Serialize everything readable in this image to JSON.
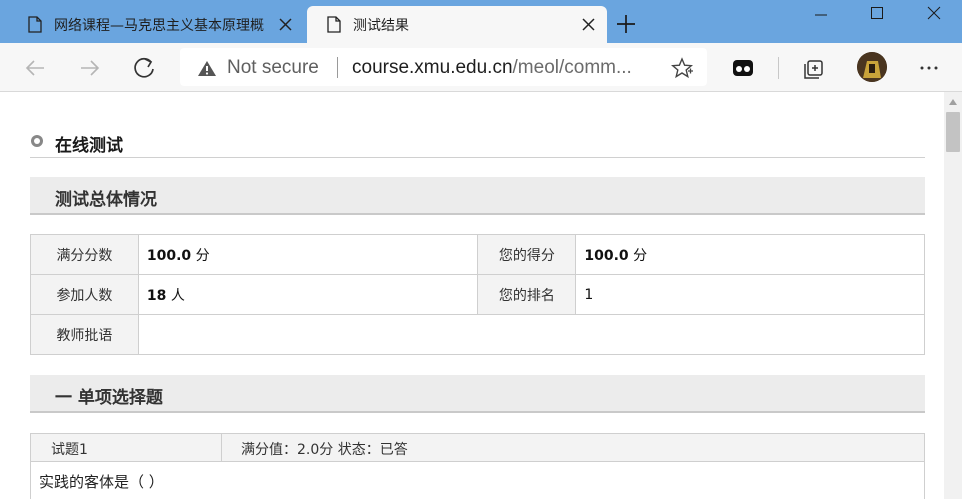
{
  "browser": {
    "tabs": [
      {
        "label": "网络课程—马克思主义基本原理概",
        "active": false
      },
      {
        "label": "测试结果",
        "active": true
      }
    ],
    "address": {
      "security_label": "Not secure",
      "url_host": "course.xmu.edu.cn",
      "url_path": "/meol/comm..."
    },
    "colors": {
      "titlebar": "#6aa5df",
      "toolbar": "#f7f7f7"
    }
  },
  "page": {
    "section_title": "在线测试",
    "summary_bar_title": "测试总体情况",
    "summary": {
      "full_score_label": "满分分数",
      "full_score_value": "100.0",
      "full_score_unit": "分",
      "my_score_label": "您的得分",
      "my_score_value": "100.0",
      "my_score_unit": "分",
      "participants_label": "参加人数",
      "participants_value": "18",
      "participants_unit": "人",
      "rank_label": "您的排名",
      "rank_value": "1",
      "comment_label": "教师批语",
      "comment_value": ""
    },
    "part_title": "一 单项选择题",
    "question": {
      "number_label": "试题1",
      "meta": "满分值：2.0分   状态：已答",
      "text": "实践的客体是（ ）"
    }
  }
}
